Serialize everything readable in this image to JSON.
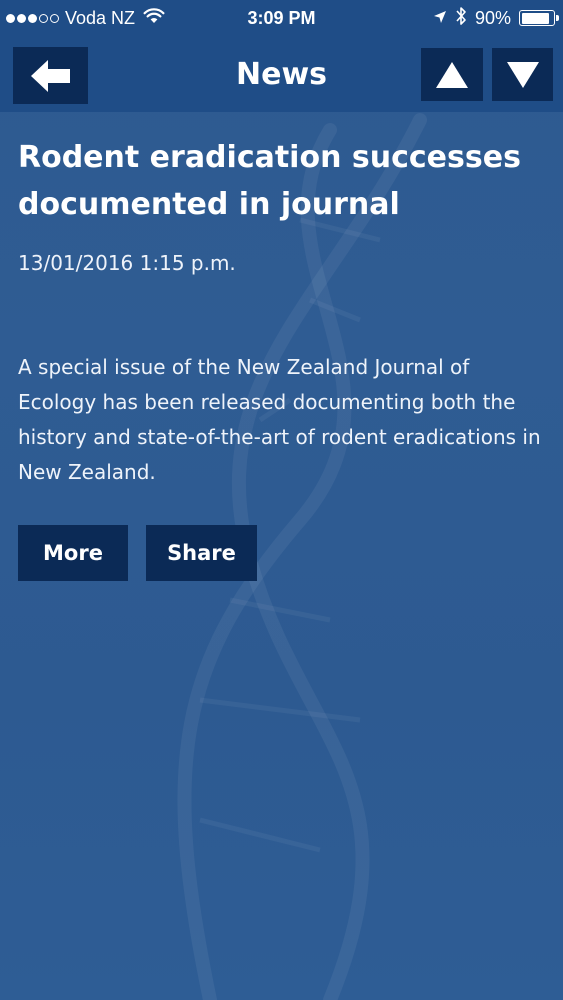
{
  "status_bar": {
    "signal_bars_filled": 3,
    "signal_bars_total": 5,
    "carrier": "Voda NZ",
    "time": "3:09 PM",
    "battery": "90%",
    "battery_level": 0.9,
    "icons": [
      "wifi-icon",
      "location-arrow-icon",
      "bluetooth-icon",
      "battery-icon"
    ]
  },
  "nav": {
    "title": "News",
    "back_icon": "arrow-left-icon",
    "up_icon": "triangle-up-icon",
    "down_icon": "triangle-down-icon"
  },
  "article": {
    "title": "Rodent eradication successes documented in journal",
    "date": "13/01/2016 1:15 p.m.",
    "summary": "A special issue of the New Zealand Journal of Ecology has been released documenting both the history and state-of-the-art of rodent eradications in New Zealand.",
    "more_label": "More",
    "share_label": "Share"
  },
  "colors": {
    "header_bg": "#1f4d87",
    "content_bg": "#2f5c93",
    "button_bg": "#0b2a56",
    "text": "#ffffff"
  }
}
